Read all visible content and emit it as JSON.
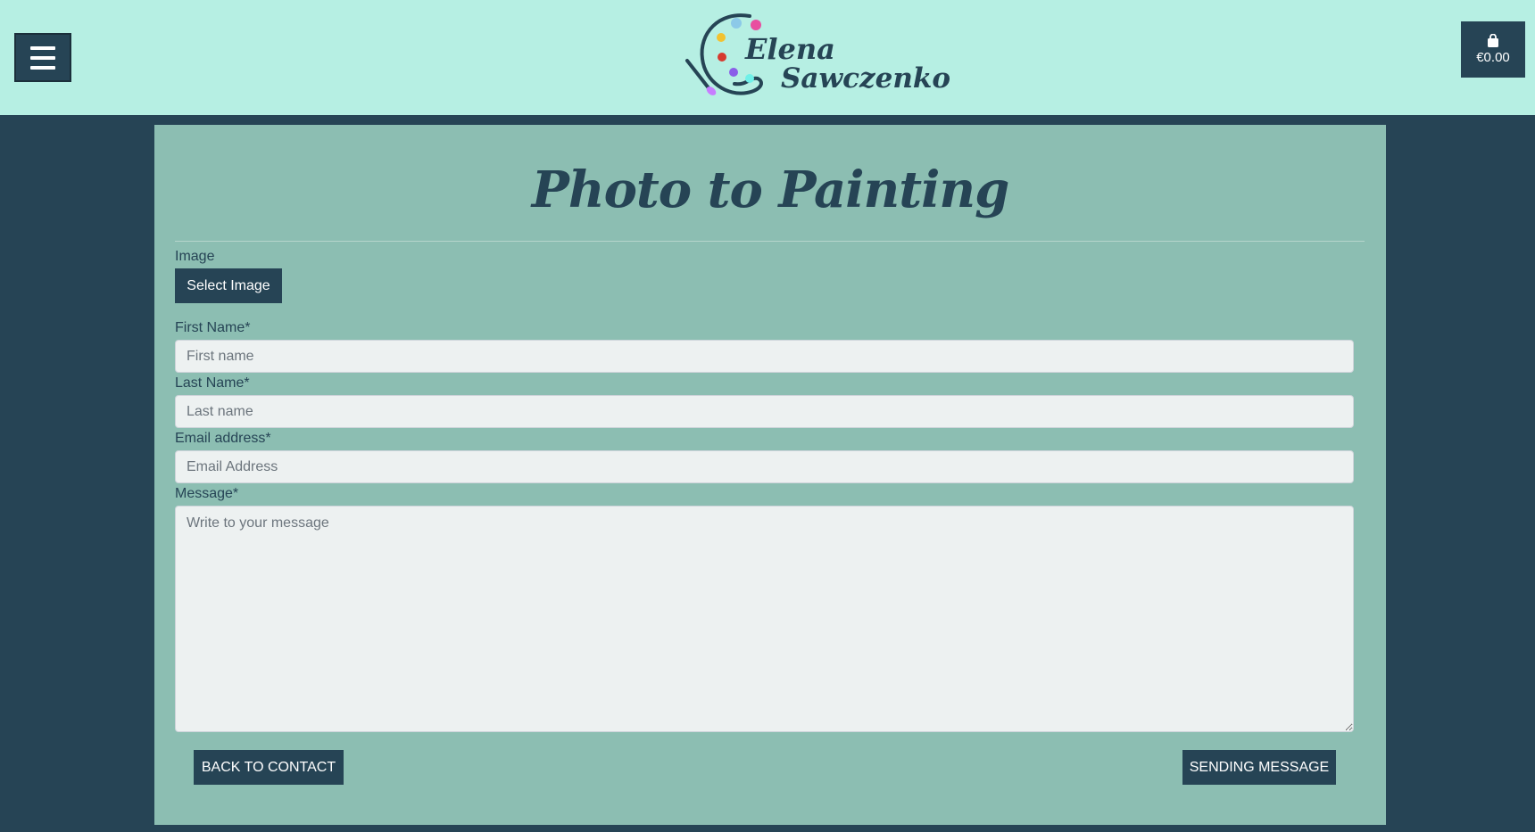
{
  "header": {
    "brand_line1": "Elena",
    "brand_line2": "Sawczenko",
    "cart_amount": "€0.00"
  },
  "page": {
    "title": "Photo to Painting"
  },
  "form": {
    "image_label": "Image",
    "select_image_label": "Select Image",
    "first_name_label": "First Name*",
    "first_name_placeholder": "First name",
    "last_name_label": "Last Name*",
    "last_name_placeholder": "Last name",
    "email_label": "Email address*",
    "email_placeholder": "Email Address",
    "message_label": "Message*",
    "message_placeholder": "Write to your message",
    "back_button_label": "BACK TO CONTACT",
    "send_button_label": "SENDING MESSAGE"
  },
  "icons": {
    "menu": "hamburger-menu-icon",
    "cart": "shopping-bag-icon",
    "logo": "palette-brush-icon"
  },
  "colors": {
    "header_bg": "#b6efe3",
    "page_bg": "#264455",
    "panel_bg": "#8cbeb2",
    "primary": "#264455"
  }
}
